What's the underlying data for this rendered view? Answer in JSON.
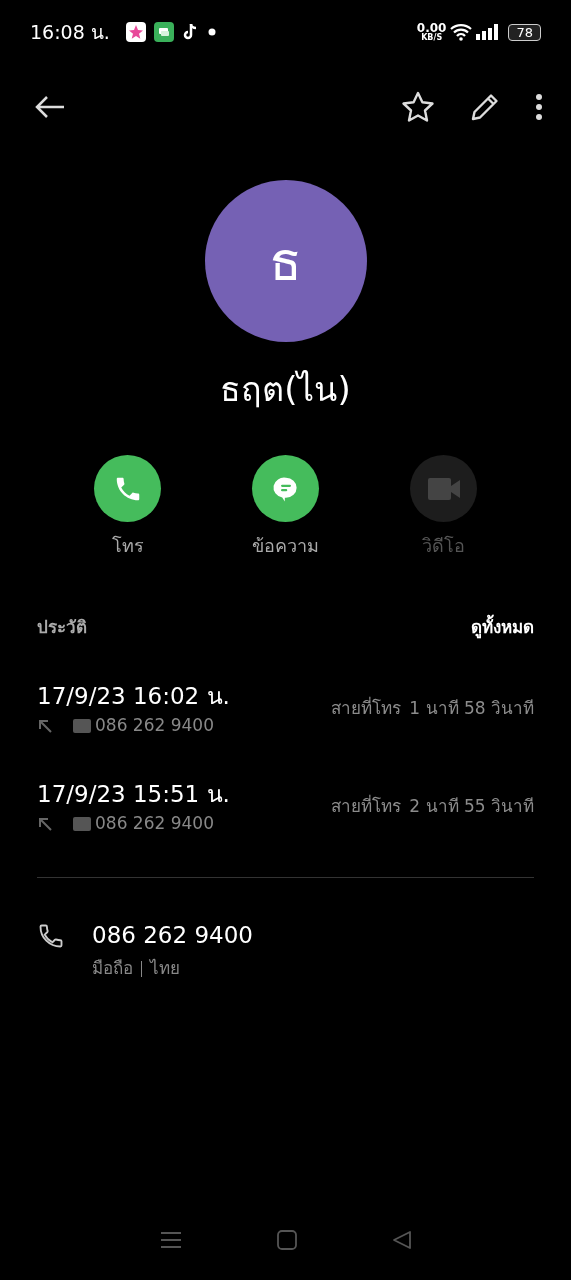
{
  "status_bar": {
    "time": "16:08 น.",
    "net_speed": "0.00",
    "net_unit": "KB/S",
    "battery": "78"
  },
  "contact": {
    "initial": "ธ",
    "name": "ธฤต(ไน)"
  },
  "actions": [
    {
      "kind": "call",
      "label": "โทร",
      "disabled": false
    },
    {
      "kind": "message",
      "label": "ข้อความ",
      "disabled": false
    },
    {
      "kind": "video",
      "label": "วิดีโอ",
      "disabled": true
    }
  ],
  "history": {
    "title": "ประวัติ",
    "view_all": "ดูทั้งหมด",
    "calls": [
      {
        "datetime": "17/9/23 16:02 น.",
        "number": "086 262 9400",
        "type": "สายที่โทร",
        "duration": "1 นาที 58 วินาที"
      },
      {
        "datetime": "17/9/23 15:51 น.",
        "number": "086 262 9400",
        "type": "สายที่โทร",
        "duration": "2 นาที 55 วินาที"
      }
    ]
  },
  "phone": {
    "number": "086 262 9400",
    "label": "มือถือ",
    "country": "ไทย"
  }
}
